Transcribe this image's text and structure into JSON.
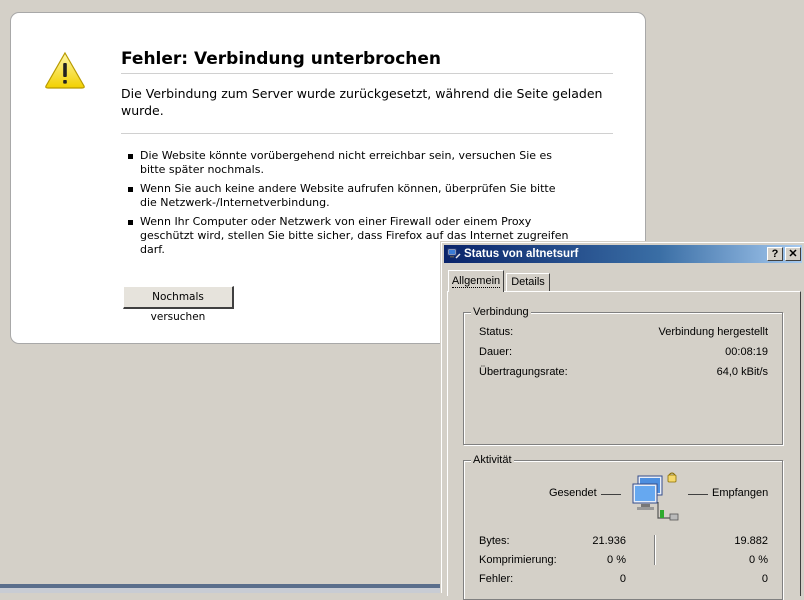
{
  "error_page": {
    "title": "Fehler: Verbindung unterbrochen",
    "description": "Die Verbindung zum Server wurde zurückgesetzt, während die Seite geladen wurde.",
    "bullets": [
      "Die Website könnte vorübergehend nicht erreichbar sein, versuchen Sie es bitte später nochmals.",
      "Wenn Sie auch keine andere Website aufrufen können, überprüfen Sie bitte die Netzwerk-/Internetverbindung.",
      "Wenn Ihr Computer oder Netzwerk von einer Firewall oder einem Proxy geschützt wird, stellen Sie bitte sicher, dass Firefox auf das Internet zugreifen darf."
    ],
    "retry_label": "Nochmals versuchen",
    "icon": "warning-icon"
  },
  "status_dialog": {
    "title": "Status von altnetsurf",
    "help_label": "?",
    "close_label": "✕",
    "tabs": [
      "Allgemein",
      "Details"
    ],
    "connection": {
      "caption": "Verbindung",
      "rows": [
        {
          "label": "Status:",
          "value": "Verbindung hergestellt"
        },
        {
          "label": "Dauer:",
          "value": "00:08:19"
        },
        {
          "label": "Übertragungsrate:",
          "value": "64,0 kBit/s"
        }
      ]
    },
    "activity": {
      "caption": "Aktivität",
      "sent_label": "Gesendet",
      "received_label": "Empfangen",
      "rows": [
        {
          "label": "Bytes:",
          "sent": "21.936",
          "received": "19.882"
        },
        {
          "label": "Komprimierung:",
          "sent": "0 %",
          "received": "0 %"
        },
        {
          "label": "Fehler:",
          "sent": "0",
          "received": "0"
        }
      ]
    }
  }
}
